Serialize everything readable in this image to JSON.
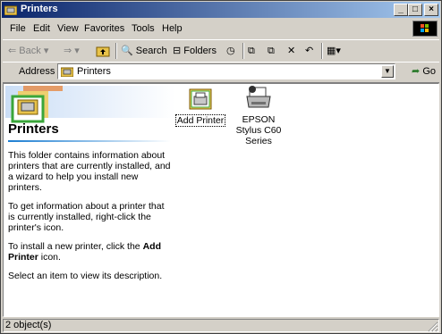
{
  "window": {
    "title": "Printers",
    "buttons": {
      "minimize": "_",
      "maximize": "□",
      "close": "×"
    }
  },
  "menu": {
    "items": [
      {
        "label": "File"
      },
      {
        "label": "Edit"
      },
      {
        "label": "View"
      },
      {
        "label": "Favorites"
      },
      {
        "label": "Tools"
      },
      {
        "label": "Help"
      }
    ]
  },
  "toolbar": {
    "back": "Back",
    "search": "Search",
    "folders": "Folders"
  },
  "address": {
    "label": "Address",
    "value": "Printers",
    "go": "Go"
  },
  "sidebar": {
    "title": "Printers",
    "p1": "This folder contains information about printers that are currently installed, and a wizard to help you install new printers.",
    "p2": "To get information about a printer that is currently installed, right-click the printer's icon.",
    "p3_pre": "To install a new printer, click the ",
    "p3_bold": "Add Printer",
    "p3_post": " icon.",
    "p4": "Select an item to view its description."
  },
  "items": [
    {
      "label": "Add Printer",
      "icon": "add-printer-icon"
    },
    {
      "label": "EPSON Stylus C60 Series",
      "icon": "printer-icon"
    }
  ],
  "status": {
    "text": "2 object(s)"
  },
  "colors": {
    "titlebar_start": "#0a246a",
    "titlebar_end": "#a6caf0",
    "face": "#d4d0c8"
  }
}
